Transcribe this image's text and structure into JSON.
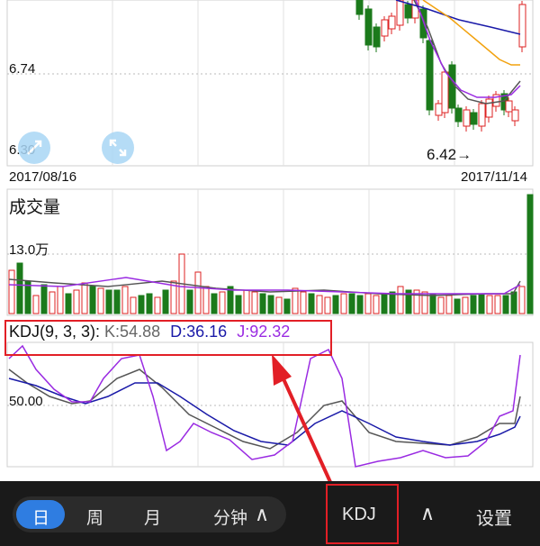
{
  "price_chart": {
    "price_high_label": "6.74",
    "price_low_label": "6.30",
    "date_start": "2017/08/16",
    "date_end": "2017/11/14",
    "min_marker": "6.42→"
  },
  "volume_chart": {
    "title": "成交量",
    "scale_label": "13.0万"
  },
  "kdj": {
    "name": "KDJ(9, 3, 3):",
    "k": "K:54.88",
    "d": "D:36.16",
    "j": "J:92.32",
    "mid_label": "50.00",
    "colors": {
      "k": "#555555",
      "d": "#1a1aa8",
      "j": "#9a2be2"
    }
  },
  "toolbar": {
    "periods": [
      "日",
      "周",
      "月"
    ],
    "minute_label": "分钟",
    "minute_arrow": "∧",
    "indicator_label": "KDJ",
    "collapse_arrow": "∧",
    "settings_label": "设置"
  },
  "icons": {
    "zoom_in": "zoom-in-icon",
    "fullscreen": "expand-icon"
  }
}
